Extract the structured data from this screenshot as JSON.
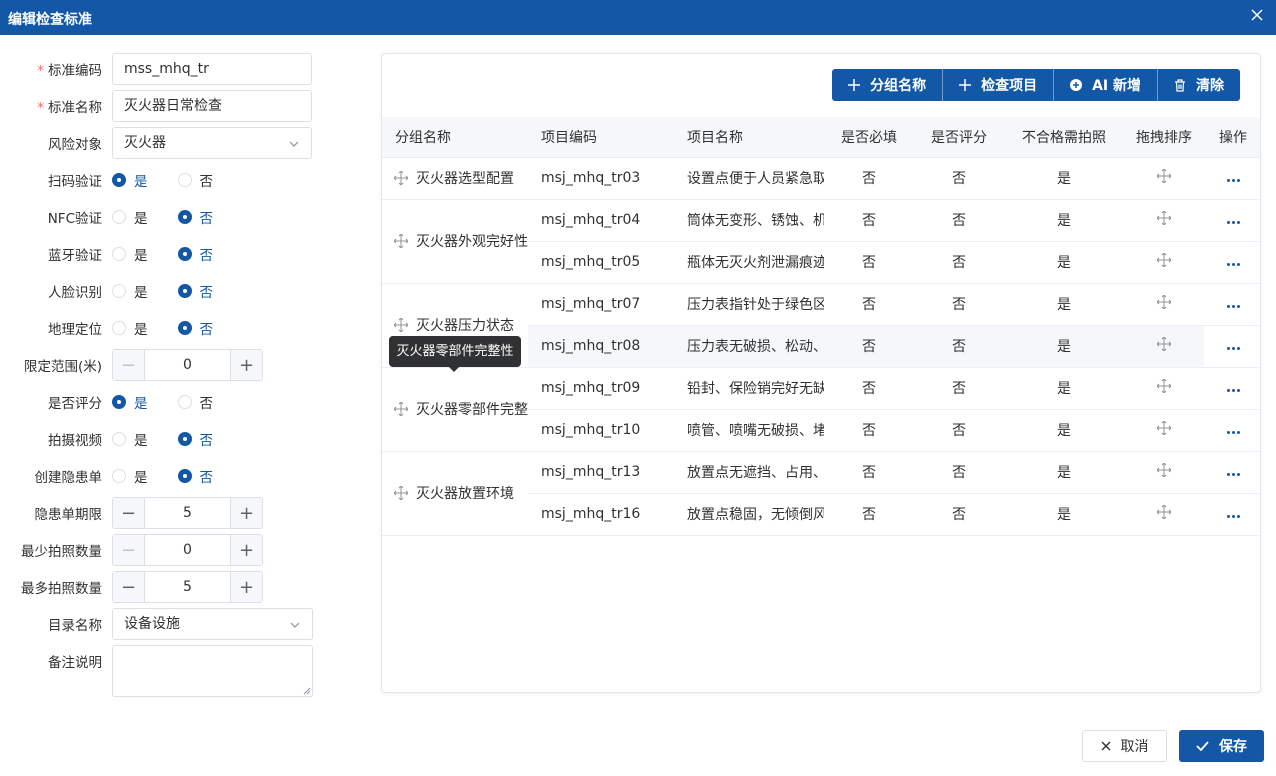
{
  "dialog": {
    "title": "编辑检查标准"
  },
  "form": {
    "std_code": {
      "label": "标准编码",
      "value": "mss_mhq_tr"
    },
    "std_name": {
      "label": "标准名称",
      "value": "灭火器日常检查"
    },
    "risk_object": {
      "label": "风险对象",
      "value": "灭火器"
    },
    "scan_verify": {
      "label": "扫码验证",
      "selected": "是"
    },
    "nfc_verify": {
      "label": "NFC验证",
      "selected": "否"
    },
    "bt_verify": {
      "label": "蓝牙验证",
      "selected": "否"
    },
    "face_verify": {
      "label": "人脸识别",
      "selected": "否"
    },
    "geo_verify": {
      "label": "地理定位",
      "selected": "否"
    },
    "range_limit": {
      "label": "限定范围(米)",
      "value": "0"
    },
    "need_score": {
      "label": "是否评分",
      "selected": "是"
    },
    "record_video": {
      "label": "拍摄视频",
      "selected": "否"
    },
    "create_hazard": {
      "label": "创建隐患单",
      "selected": "否"
    },
    "hazard_deadline": {
      "label": "隐患单期限",
      "value": "5"
    },
    "min_photos": {
      "label": "最少拍照数量",
      "value": "0"
    },
    "max_photos": {
      "label": "最多拍照数量",
      "value": "5"
    },
    "catalog": {
      "label": "目录名称",
      "value": "设备设施"
    },
    "remark": {
      "label": "备注说明",
      "value": ""
    },
    "yes": "是",
    "no": "否",
    "required_mark": "*"
  },
  "toolbar": {
    "group_name": "分组名称",
    "check_item": "检查项目",
    "ai_add": "AI 新增",
    "clear": "清除"
  },
  "table": {
    "headers": [
      "分组名称",
      "项目编码",
      "项目名称",
      "是否必填",
      "是否评分",
      "不合格需拍照",
      "拖拽排序",
      "操作"
    ],
    "groups": [
      {
        "name": "灭火器选型配置"
      },
      {
        "name": "灭火器外观完好性"
      },
      {
        "name": "灭火器压力状态"
      },
      {
        "name": "灭火器零部件完整性"
      },
      {
        "name": "灭火器放置环境"
      }
    ],
    "rows": [
      {
        "code": "msj_mhq_tr03",
        "name": "设置点便于人员紧急取用",
        "required": "否",
        "score": "否",
        "photo": "是"
      },
      {
        "code": "msj_mhq_tr04",
        "name": "筒体无变形、锈蚀、机械损伤",
        "required": "否",
        "score": "否",
        "photo": "是"
      },
      {
        "code": "msj_mhq_tr05",
        "name": "瓶体无灭火剂泄漏痕迹",
        "required": "否",
        "score": "否",
        "photo": "是"
      },
      {
        "code": "msj_mhq_tr07",
        "name": "压力表指针处于绿色区域",
        "required": "否",
        "score": "否",
        "photo": "是"
      },
      {
        "code": "msj_mhq_tr08",
        "name": "压力表无破损、松动、模糊",
        "required": "否",
        "score": "否",
        "photo": "是"
      },
      {
        "code": "msj_mhq_tr09",
        "name": "铅封、保险销完好无缺失",
        "required": "否",
        "score": "否",
        "photo": "是"
      },
      {
        "code": "msj_mhq_tr10",
        "name": "喷管、喷嘴无破损、堵塞",
        "required": "否",
        "score": "否",
        "photo": "是"
      },
      {
        "code": "msj_mhq_tr13",
        "name": "放置点无遮挡、占用、埋压",
        "required": "否",
        "score": "否",
        "photo": "是"
      },
      {
        "code": "msj_mhq_tr16",
        "name": "放置点稳固，无倾倒风险",
        "required": "否",
        "score": "否",
        "photo": "是"
      }
    ]
  },
  "tooltip": {
    "text": "灭火器零部件完整性"
  },
  "footer": {
    "cancel": "取消",
    "save": "保存"
  },
  "colors": {
    "primary": "#1358a6",
    "required": "#f56c6c",
    "tooltip_bg": "#303133"
  },
  "icons": {
    "close": "close-icon",
    "plus": "plus-icon",
    "ai": "ai-plus-circle-icon",
    "clear": "trash-icon",
    "drag": "move-icon",
    "more": "ellipsis-icon",
    "check": "check-icon",
    "x": "x-icon"
  }
}
